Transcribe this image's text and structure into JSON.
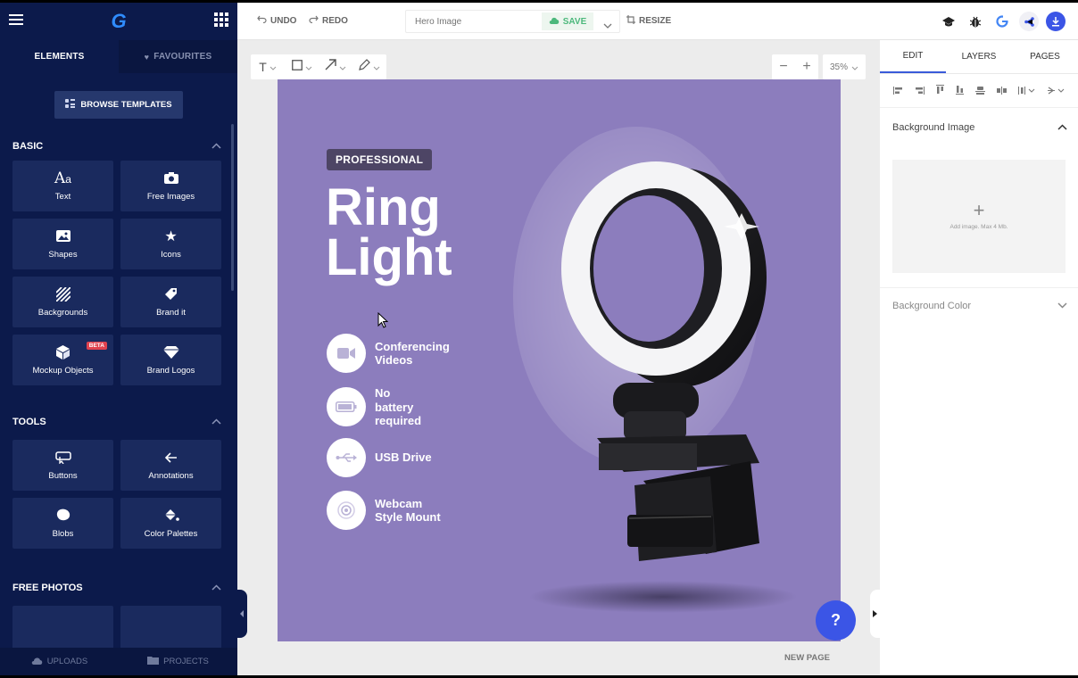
{
  "app": {
    "logo": "G"
  },
  "sidebar": {
    "tabs": [
      {
        "label": "ELEMENTS"
      },
      {
        "label": "FAVOURITES"
      }
    ],
    "browse_label": "BROWSE TEMPLATES",
    "sections": {
      "basic": {
        "title": "BASIC",
        "items": [
          {
            "label": "Text",
            "icon": "text-icon"
          },
          {
            "label": "Free Images",
            "icon": "camera-icon"
          },
          {
            "label": "Shapes",
            "icon": "image-icon"
          },
          {
            "label": "Icons",
            "icon": "star-icon"
          },
          {
            "label": "Backgrounds",
            "icon": "stripes-icon"
          },
          {
            "label": "Brand it",
            "icon": "tag-icon"
          },
          {
            "label": "Mockup Objects",
            "icon": "cube-icon",
            "badge": "BETA"
          },
          {
            "label": "Brand Logos",
            "icon": "diamond-icon"
          }
        ]
      },
      "tools": {
        "title": "TOOLS",
        "items": [
          {
            "label": "Buttons",
            "icon": "button-icon"
          },
          {
            "label": "Annotations",
            "icon": "arrow-left-icon"
          },
          {
            "label": "Blobs",
            "icon": "blob-icon"
          },
          {
            "label": "Color Palettes",
            "icon": "paint-bucket-icon"
          }
        ]
      },
      "free_photos": {
        "title": "FREE PHOTOS"
      }
    },
    "bottom": [
      {
        "label": "UPLOADS"
      },
      {
        "label": "PROJECTS"
      }
    ]
  },
  "toolbar": {
    "undo": "UNDO",
    "redo": "REDO",
    "title_placeholder": "Hero Image",
    "save": "SAVE",
    "resize": "RESIZE"
  },
  "canvas_tools": {
    "zoom": "35%"
  },
  "artboard": {
    "badge": "PROFESSIONAL",
    "title_line1": "Ring",
    "title_line2": "Light",
    "features": [
      {
        "line1": "Conferencing",
        "line2": "Videos",
        "line3": ""
      },
      {
        "line1": "No",
        "line2": "battery",
        "line3": "required"
      },
      {
        "line1": "USB Drive",
        "line2": "",
        "line3": ""
      },
      {
        "line1": "Webcam",
        "line2": "Style Mount",
        "line3": ""
      }
    ],
    "bg_color": "#8c7dbd"
  },
  "right_panel": {
    "tabs": [
      {
        "label": "EDIT"
      },
      {
        "label": "LAYERS"
      },
      {
        "label": "PAGES"
      }
    ],
    "bg_image_label": "Background Image",
    "upload_hint": "Add image. Max 4 Mb.",
    "bg_color_label": "Background Color"
  },
  "help": "?",
  "new_page": "NEW PAGE"
}
